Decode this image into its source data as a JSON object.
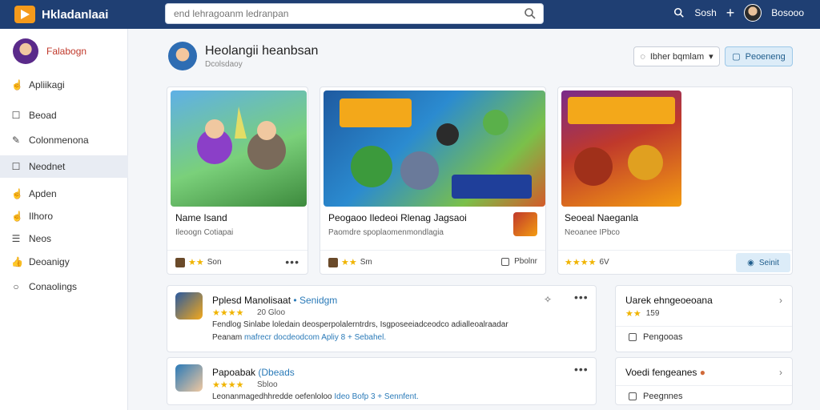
{
  "app": {
    "title": "Hkladanlaai"
  },
  "search": {
    "placeholder": "end lehragoanm ledranpan"
  },
  "topbar": {
    "search_label": "Sosh",
    "user_name": "Bosooo"
  },
  "sidebar": {
    "profile_name": "Falabogn",
    "items": [
      {
        "label": "Apliikagi",
        "icon": "hand-icon"
      },
      {
        "label": "Beoad",
        "icon": "square-icon"
      },
      {
        "label": "Colonmenona",
        "icon": "pencil-icon"
      },
      {
        "label": "Neodnet",
        "icon": "square-icon"
      },
      {
        "label": "Apden",
        "icon": "hand-icon"
      },
      {
        "label": "Ilhoro",
        "icon": "hand-icon"
      },
      {
        "label": "Neos",
        "icon": "list-icon"
      },
      {
        "label": "Deoanigy",
        "icon": "thumbs-up-icon"
      },
      {
        "label": "Conaolings",
        "icon": "chat-icon"
      }
    ]
  },
  "header": {
    "title": "Heolangii heanbsan",
    "subtitle": "Dcolsdaoy",
    "sort_label": "Ibher bqmlam",
    "primary_label": "Peoeneng"
  },
  "cards": [
    {
      "title": "Name Isand",
      "subtitle": "Ileoogn Cotiapai",
      "rating_text": "Son",
      "stars": "★★",
      "foot_action": ""
    },
    {
      "title": "Peogaoo Iledeoi Rlenag Jagsaoi",
      "subtitle": "Paomdre spoplaomenmondlagia",
      "rating_text": "Sm",
      "stars": "★★",
      "foot_action": "Pbolnr"
    },
    {
      "title": "Seoeal Naeganla",
      "subtitle": "Neoanee IPbco",
      "rating_text": "6V",
      "stars": "★★★★",
      "foot_action": "Seinit"
    }
  ],
  "list": [
    {
      "name": "Pplesd Manolisaat",
      "tag": "• Senidgm",
      "stars": "★★★★",
      "meta": "20 Gloo",
      "desc1": "Fendlog Sinlabe loledain deosperpolalerntrdrs, Isgposeeiadceodco adialleoalraadar",
      "desc2a": "Peanam",
      "desc2b": "mafrecr docdeodcom",
      "desc2c": "Apliy 8 + Sebahel."
    },
    {
      "name": "Papoabak",
      "tag": "(Dbeads",
      "stars": "★★★★",
      "meta": "Sbloo",
      "desc1": "Leonanmagedhhredde oefenloloo",
      "desc2a": "",
      "desc2b": "Ideo",
      "desc2c": "Bofp 3 + Sennfent."
    }
  ],
  "side": [
    {
      "title": "Uarek ehngeoeoana",
      "stars": "★★",
      "meta": "159",
      "action": "Pengooas"
    },
    {
      "title": "Voedi fengeanes",
      "stars": "",
      "meta": "",
      "action": "Peegnnes"
    }
  ],
  "colors": {
    "topbar": "#1f3f73",
    "accent": "#f59a1b",
    "link": "#2a7ab8"
  }
}
